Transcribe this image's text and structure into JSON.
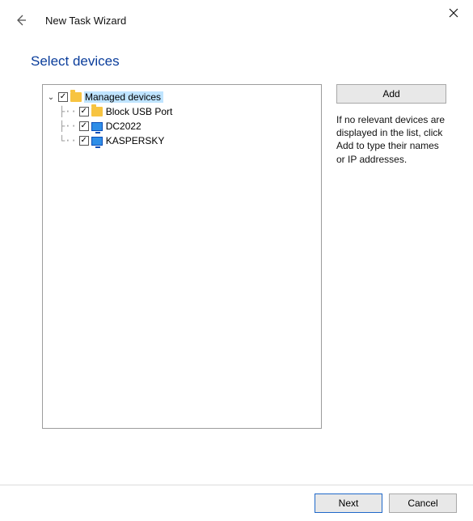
{
  "titlebar": {
    "wizard_title": "New Task Wizard"
  },
  "page": {
    "heading": "Select devices"
  },
  "tree": {
    "root": {
      "label": "Managed devices",
      "expanded": true,
      "checked": true,
      "selected": true
    },
    "children": [
      {
        "label": "Block USB Port",
        "checked": true,
        "icon": "folder"
      },
      {
        "label": "DC2022",
        "checked": true,
        "icon": "monitor"
      },
      {
        "label": "KASPERSKY",
        "checked": true,
        "icon": "monitor"
      }
    ]
  },
  "sidebar": {
    "add_label": "Add",
    "hint": "If no relevant devices are displayed in the list, click Add to type their names or IP addresses."
  },
  "footer": {
    "next_label": "Next",
    "cancel_label": "Cancel"
  }
}
